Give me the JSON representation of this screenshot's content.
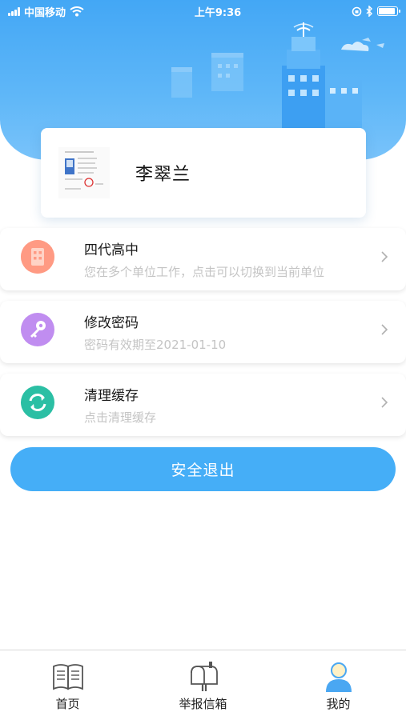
{
  "status_bar": {
    "carrier": "中国移动",
    "time": "上午9:36"
  },
  "profile": {
    "name": "李翠兰",
    "avatar_icon": "id-document-thumbnail"
  },
  "menu": [
    {
      "title": "四代高中",
      "subtitle": "您在多个单位工作，点击可以切换到当前单位",
      "icon": "building-icon",
      "color": "#ff8f77"
    },
    {
      "title": "修改密码",
      "subtitle": "密码有效期至2021-01-10",
      "icon": "key-icon",
      "color": "#c28cf0"
    },
    {
      "title": "清理缓存",
      "subtitle": "点击清理缓存",
      "icon": "refresh-icon",
      "color": "#2fbfa6"
    }
  ],
  "logout": {
    "label": "安全退出"
  },
  "tabs": [
    {
      "label": "首页",
      "icon": "book-icon"
    },
    {
      "label": "举报信箱",
      "icon": "mailbox-icon"
    },
    {
      "label": "我的",
      "icon": "user-icon"
    }
  ],
  "colors": {
    "primary": "#45aef7",
    "header": "#43a7f5"
  }
}
